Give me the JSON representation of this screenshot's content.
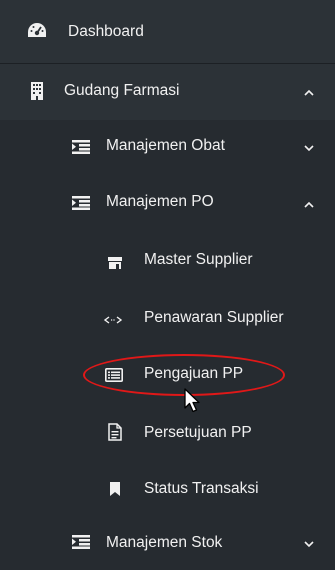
{
  "menu": {
    "dashboard": {
      "label": "Dashboard",
      "icon": "dashboard-icon"
    },
    "gudang": {
      "label": "Gudang Farmasi",
      "icon": "building-icon",
      "expanded": true
    },
    "obat": {
      "label": "Manajemen Obat",
      "icon": "list-icon",
      "expanded": false
    },
    "po": {
      "label": "Manajemen PO",
      "icon": "list-icon",
      "expanded": true
    },
    "po_items": [
      {
        "label": "Master Supplier",
        "icon": "store-icon"
      },
      {
        "label": "Penawaran Supplier",
        "icon": "exchange-icon"
      },
      {
        "label": "Pengajuan PP",
        "icon": "list-alt-icon",
        "highlighted": true
      },
      {
        "label": "Persetujuan PP",
        "icon": "file-text-icon"
      },
      {
        "label": "Status Transaksi",
        "icon": "bookmark-icon"
      }
    ],
    "stok": {
      "label": "Manajemen Stok",
      "icon": "list-icon",
      "expanded": false
    }
  },
  "colors": {
    "background": "#2c3237",
    "submenu_background": "#262b30",
    "text": "#f1f1f1",
    "highlight_ring": "#e01818"
  }
}
